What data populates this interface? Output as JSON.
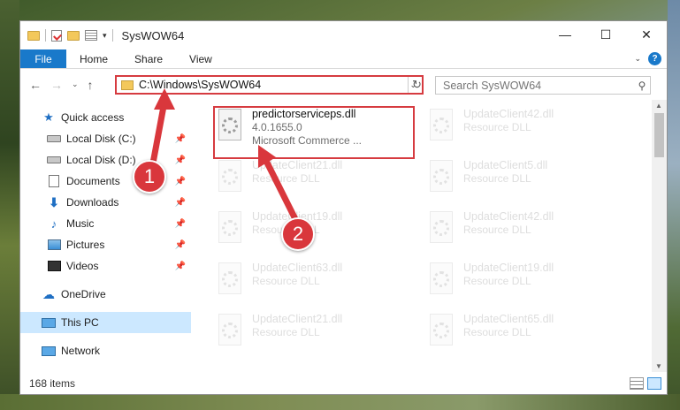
{
  "window": {
    "title": "SysWOW64",
    "controls": {
      "minimize": "—",
      "maximize": "☐",
      "close": "✕"
    }
  },
  "ribbon": {
    "tabs": [
      {
        "label": "File",
        "active": true
      },
      {
        "label": "Home"
      },
      {
        "label": "Share"
      },
      {
        "label": "View"
      }
    ]
  },
  "navigation": {
    "back": "←",
    "forward": "→",
    "recent": "⌄",
    "up": "↑"
  },
  "address": {
    "path": "C:\\Windows\\SysWOW64"
  },
  "search": {
    "placeholder": "Search SysWOW64"
  },
  "sidebar": {
    "items": [
      {
        "label": "Quick access",
        "icon": "star-icon",
        "pinned": false
      },
      {
        "label": "Local Disk (C:)",
        "icon": "disk-icon",
        "pinned": true
      },
      {
        "label": "Local Disk (D:)",
        "icon": "disk-icon",
        "pinned": true
      },
      {
        "label": "Documents",
        "icon": "documents-icon",
        "pinned": true
      },
      {
        "label": "Downloads",
        "icon": "download-icon",
        "pinned": true
      },
      {
        "label": "Music",
        "icon": "music-icon",
        "pinned": true
      },
      {
        "label": "Pictures",
        "icon": "pictures-icon",
        "pinned": true
      },
      {
        "label": "Videos",
        "icon": "videos-icon",
        "pinned": true
      },
      {
        "label": "OneDrive",
        "icon": "onedrive-icon",
        "pinned": false
      },
      {
        "label": "This PC",
        "icon": "pc-icon",
        "selected": true
      },
      {
        "label": "Network",
        "icon": "network-icon",
        "pinned": false
      }
    ]
  },
  "files": {
    "highlighted": {
      "name": "predictorserviceps.dll",
      "version": "4.0.1655.0",
      "company": "Microsoft Commerce ..."
    },
    "left_column": [
      {
        "name": "UpdateClient21.dll",
        "type": "Resource DLL"
      },
      {
        "name": "UpdateClient19.dll",
        "type": "Resource DLL"
      },
      {
        "name": "UpdateClient63.dll",
        "type": "Resource DLL"
      },
      {
        "name": "UpdateClient21.dll",
        "type": "Resource DLL"
      }
    ],
    "right_column": [
      {
        "name": "UpdateClient42.dll",
        "type": "Resource DLL"
      },
      {
        "name": "UpdateClient5.dll",
        "type": "Resource DLL"
      },
      {
        "name": "UpdateClient42.dll",
        "type": "Resource DLL"
      },
      {
        "name": "UpdateClient19.dll",
        "type": "Resource DLL"
      },
      {
        "name": "UpdateClient65.dll",
        "type": "Resource DLL"
      }
    ]
  },
  "status": {
    "item_count": "168 items"
  },
  "callouts": {
    "one": "1",
    "two": "2"
  },
  "colors": {
    "accent": "#1979ca",
    "annotation_red": "#d63b40",
    "selection": "#cce8ff"
  }
}
